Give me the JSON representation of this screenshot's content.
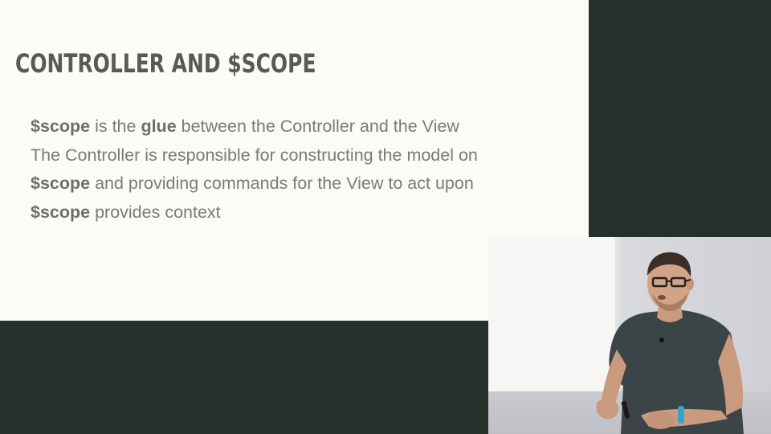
{
  "slide": {
    "title": "CONTROLLER AND $SCOPE",
    "bullets": [
      {
        "kw1": "$scope",
        "t1": " is the ",
        "kw2": "glue",
        "t2": " between the Controller and the View"
      },
      {
        "text": "The Controller is responsible for constructing the model on"
      },
      {
        "kw1": "$scope",
        "t1": " and providing commands for the View to act upon"
      },
      {
        "kw1": "$scope",
        "t1": " provides context"
      }
    ]
  },
  "colors": {
    "slide_background": "#fbfcf6",
    "frame_background": "#24302a",
    "title_text": "#5a5a55",
    "body_text": "#7b7b77"
  },
  "camera_feed": {
    "subject": "presenter",
    "icon": "presenter-video"
  }
}
